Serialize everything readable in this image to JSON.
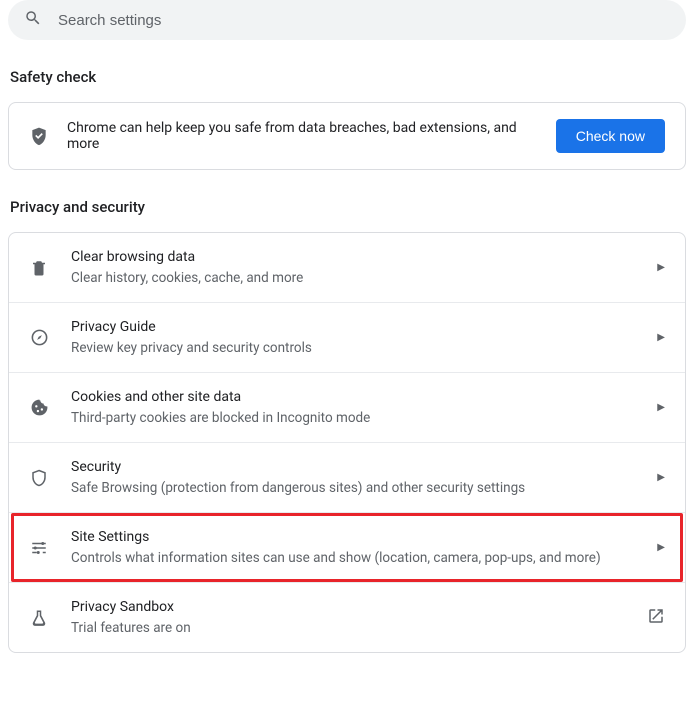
{
  "search": {
    "placeholder": "Search settings"
  },
  "sections": {
    "safety": {
      "title": "Safety check",
      "text": "Chrome can help keep you safe from data breaches, bad extensions, and more",
      "button": "Check now"
    },
    "privacy": {
      "title": "Privacy and security",
      "items": [
        {
          "title": "Clear browsing data",
          "sub": "Clear history, cookies, cache, and more"
        },
        {
          "title": "Privacy Guide",
          "sub": "Review key privacy and security controls"
        },
        {
          "title": "Cookies and other site data",
          "sub": "Third-party cookies are blocked in Incognito mode"
        },
        {
          "title": "Security",
          "sub": "Safe Browsing (protection from dangerous sites) and other security settings"
        },
        {
          "title": "Site Settings",
          "sub": "Controls what information sites can use and show (location, camera, pop-ups, and more)"
        },
        {
          "title": "Privacy Sandbox",
          "sub": "Trial features are on"
        }
      ]
    }
  }
}
